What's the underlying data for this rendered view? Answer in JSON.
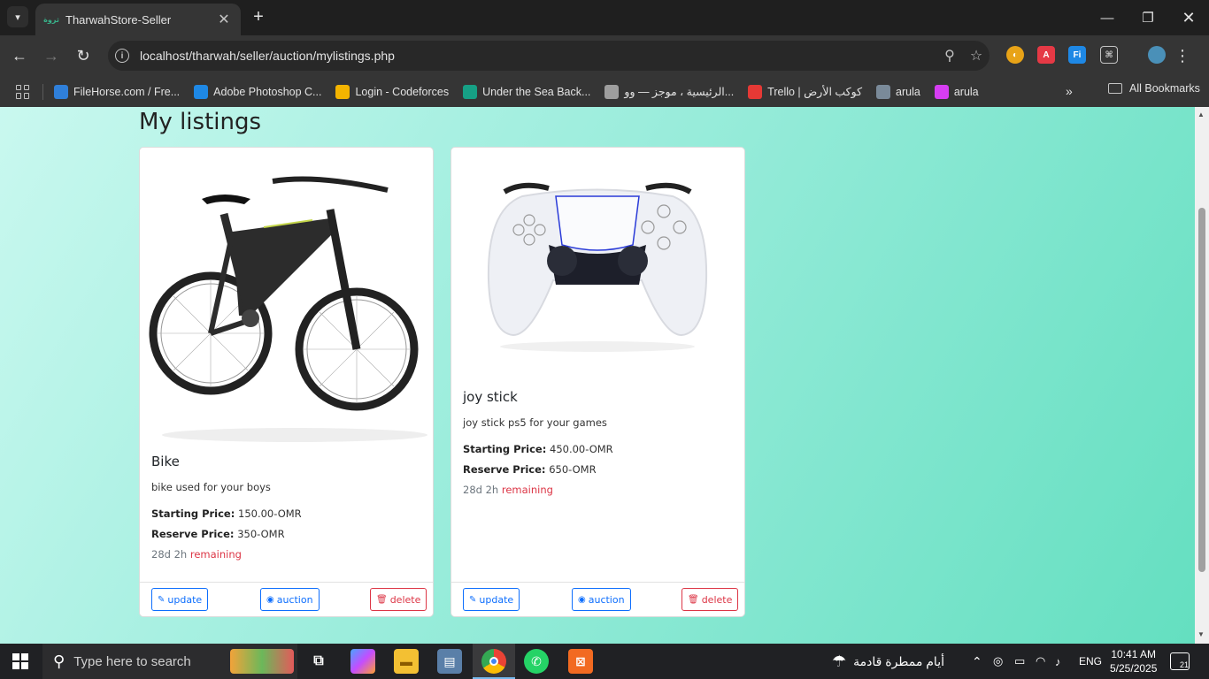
{
  "browser": {
    "tab_title": "TharwahStore-Seller",
    "tab_favicon": "ثروة",
    "url": "localhost/tharwah/seller/auction/mylistings.php",
    "bookmarks": [
      {
        "label": "FileHorse.com / Fre...",
        "color": "#2f7fd9"
      },
      {
        "label": "Adobe Photoshop C...",
        "color": "#1e88e5"
      },
      {
        "label": "Login - Codeforces",
        "color": "#f4b400"
      },
      {
        "label": "Under the Sea Back...",
        "color": "#16a085"
      },
      {
        "label": "الرئيسية ، موجز — وو...",
        "color": "#9e9e9e"
      },
      {
        "label": "Trello | كوكب الأرض",
        "color": "#e53935"
      },
      {
        "label": "arula",
        "color": "#7a8a99"
      },
      {
        "label": "arula",
        "color": "#d63df2"
      }
    ],
    "all_bookmarks": "All Bookmarks",
    "more_bookmarks": "»"
  },
  "page": {
    "title": "My listings",
    "listings": [
      {
        "name": "Bike",
        "description": "bike used for your boys",
        "starting_label": "Starting Price:",
        "starting_price": "150.00-OMR",
        "reserve_label": "Reserve Price:",
        "reserve_price": "350-OMR",
        "time_left": "28d 2h",
        "remaining": "remaining",
        "update": "update",
        "auction": "auction",
        "delete": "delete"
      },
      {
        "name": "joy stick",
        "description": "joy stick ps5 for your games",
        "starting_label": "Starting Price:",
        "starting_price": "450.00-OMR",
        "reserve_label": "Reserve Price:",
        "reserve_price": "650-OMR",
        "time_left": "28d 2h",
        "remaining": "remaining",
        "update": "update",
        "auction": "auction",
        "delete": "delete"
      }
    ]
  },
  "taskbar": {
    "search_placeholder": "Type here to search",
    "weather_text": "أيام ممطرة قادمة",
    "language": "ENG",
    "time": "10:41 AM",
    "date": "5/25/2025",
    "notification_count": "21"
  }
}
